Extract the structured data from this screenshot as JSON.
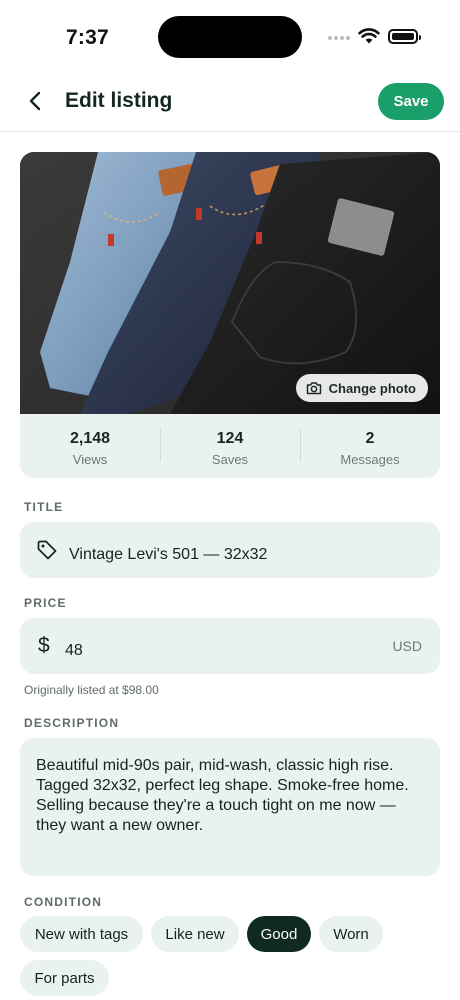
{
  "status_bar": {
    "time": "7:37"
  },
  "header": {
    "title": "Edit listing",
    "save_label": "Save"
  },
  "photo": {
    "change_label": "Change photo"
  },
  "stats": [
    {
      "value": "2,148",
      "label": "Views"
    },
    {
      "value": "124",
      "label": "Saves"
    },
    {
      "value": "2",
      "label": "Messages"
    }
  ],
  "title_field": {
    "label": "TITLE",
    "value": "Vintage Levi's 501 — 32x32"
  },
  "price_field": {
    "label": "PRICE",
    "symbol": "$",
    "value": "48",
    "currency": "USD",
    "hint": "Originally listed at $98.00"
  },
  "description_field": {
    "label": "DESCRIPTION",
    "value": "Beautiful mid-90s pair, mid-wash, classic high rise. Tagged 32x32, perfect leg shape. Smoke-free home. Selling because they're a touch tight on me now — they want a new owner."
  },
  "condition": {
    "label": "CONDITION",
    "selected": "Good",
    "options": [
      "New with tags",
      "Like new",
      "Good",
      "Worn",
      "For parts"
    ]
  },
  "colors": {
    "accent": "#1a9e6a",
    "field_bg": "#e9f2ed",
    "chip_selected": "#0f2a1f"
  }
}
